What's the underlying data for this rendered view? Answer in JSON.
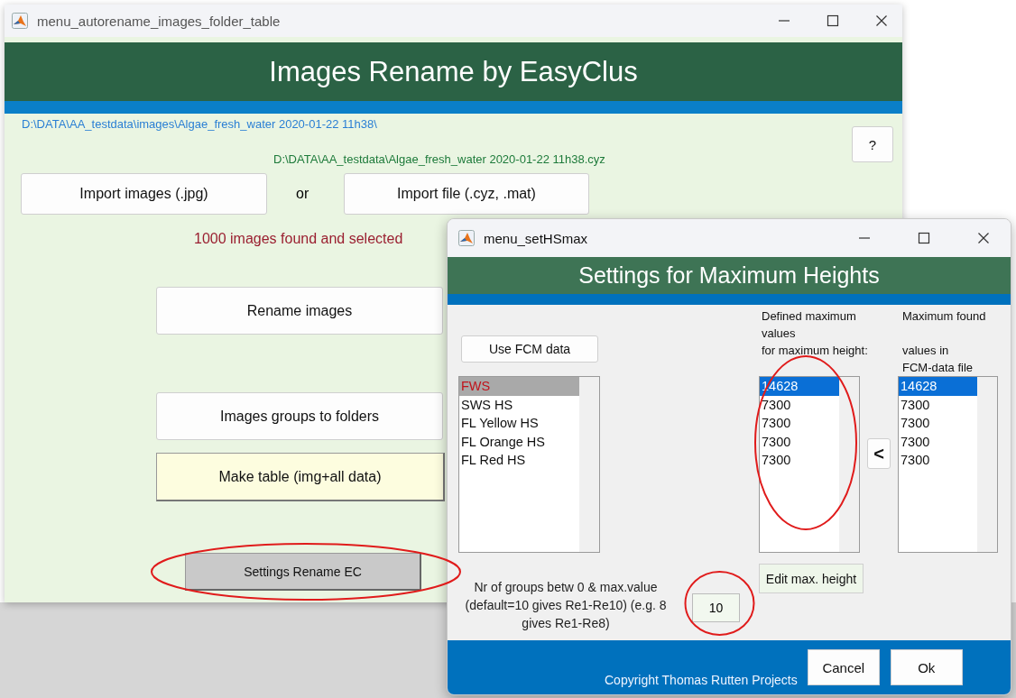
{
  "main_window": {
    "title": "menu_autorename_images_folder_table",
    "header": "Images Rename by EasyClus",
    "images_path": "D:\\DATA\\AA_testdata\\images\\Algae_fresh_water 2020-01-22 11h38\\",
    "file_path": "D:\\DATA\\AA_testdata\\Algae_fresh_water 2020-01-22 11h38.cyz",
    "help_button": "?",
    "import_images_button": "Import images (.jpg)",
    "or_label": "or",
    "import_file_button": "Import file (.cyz, .mat)",
    "status": "1000 images found and selected",
    "action_buttons": [
      {
        "label": "Rename images",
        "kind": "plain",
        "circled": false
      },
      {
        "label": "Images groups to folders",
        "kind": "plain",
        "circled": false
      },
      {
        "label": "Make table (img+all data)",
        "kind": "accent",
        "circled": false
      },
      {
        "label": "Settings Rename EC",
        "kind": "pressed",
        "circled": true
      }
    ]
  },
  "dialog": {
    "title": "menu_setHSmax",
    "header": "Settings for Maximum Heights",
    "use_fcm_button": "Use FCM data",
    "parameters": {
      "items": [
        {
          "label": "FWS",
          "selected": true
        },
        {
          "label": "SWS HS",
          "selected": false
        },
        {
          "label": "FL Yellow HS",
          "selected": false
        },
        {
          "label": "FL Orange HS",
          "selected": false
        },
        {
          "label": "FL Red HS",
          "selected": false
        }
      ]
    },
    "defined": {
      "label_lines": [
        "Defined maximum",
        "values",
        "for maximum height:"
      ],
      "circled": true,
      "items": [
        {
          "label": "14628",
          "selected": true
        },
        {
          "label": "7300",
          "selected": false
        },
        {
          "label": "7300",
          "selected": false
        },
        {
          "label": "7300",
          "selected": false
        },
        {
          "label": "7300",
          "selected": false
        }
      ]
    },
    "copy_button": "<",
    "found": {
      "label_lines": [
        "Maximum found",
        "values in",
        "FCM-data file"
      ],
      "items": [
        {
          "label": "14628",
          "selected": true
        },
        {
          "label": "7300",
          "selected": false
        },
        {
          "label": "7300",
          "selected": false
        },
        {
          "label": "7300",
          "selected": false
        },
        {
          "label": "7300",
          "selected": false
        }
      ]
    },
    "edit_button": "Edit max. height",
    "groups_label": "Nr of groups betw 0 & max.value (default=10 gives Re1-Re10) (e.g. 8 gives Re1-Re8)",
    "groups_field": {
      "value": "10",
      "circled": true
    },
    "copyright": "Copyright Thomas Rutten Projects",
    "cancel_button": "Cancel",
    "ok_button": "Ok"
  }
}
